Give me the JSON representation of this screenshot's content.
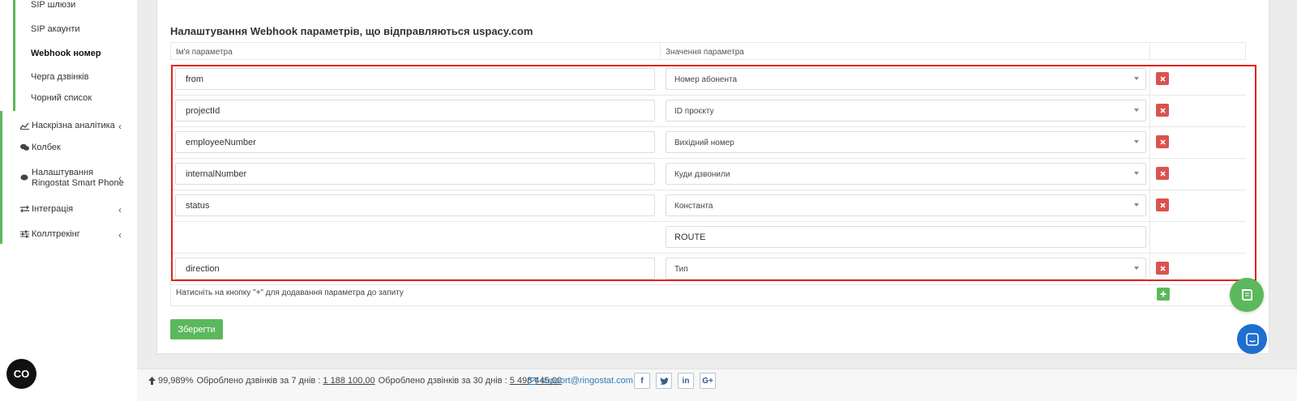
{
  "sidebar": {
    "sub_items": [
      "SIP шлюзи",
      "SIP акаунти",
      "Webhook номер",
      "Черга дзвінків",
      "Чорний список"
    ],
    "active_sub_item": "Webhook номер",
    "main_items": [
      {
        "label": "Наскрізна аналітика",
        "icon": "line-chart-icon",
        "has_chevron": true
      },
      {
        "label": "Колбек",
        "icon": "chat-bubbles-icon",
        "has_chevron": false
      },
      {
        "label_line1": "Налаштування",
        "label_line2": "Ringostat Smart Phone",
        "icon": "chat-icon",
        "has_chevron": true
      },
      {
        "label": "Інтеграція",
        "icon": "exchange-icon",
        "has_chevron": true
      },
      {
        "label": "Коллтрекінг",
        "icon": "sliders-icon",
        "has_chevron": true
      }
    ]
  },
  "panel": {
    "title": "Налаштування Webhook параметрів, що відправляються uspacy.com",
    "columns": {
      "name": "Ім'я параметра",
      "value": "Значення параметра"
    },
    "rows": [
      {
        "name": "from",
        "value": "Номер абонента",
        "type": "select"
      },
      {
        "name": "projectId",
        "value": "ID проєкту",
        "type": "select"
      },
      {
        "name": "employeeNumber",
        "value": "Вихідний номер",
        "type": "select"
      },
      {
        "name": "internalNumber",
        "value": "Куди дзвонили",
        "type": "select"
      },
      {
        "name": "status",
        "value": "Константа",
        "type": "select"
      },
      {
        "name": "",
        "value": "ROUTE",
        "type": "text"
      },
      {
        "name": "direction",
        "value": "Тип",
        "type": "select"
      }
    ],
    "hint": "Натисніть на кнопку \"+\" для додавання параметра до запиту",
    "save_label": "Зберегти"
  },
  "footer": {
    "uptime": "99,989%",
    "stat7_label": "Оброблено дзвінків за 7 днів :",
    "stat7_value": "1 188 100,00",
    "stat30_label": "Оброблено дзвінків за 30 днів :",
    "stat30_value": "5 498 445,00",
    "support_email": "support@ringostat.com",
    "socials": [
      "f",
      "t",
      "in",
      "G+"
    ]
  },
  "fabs": {
    "co_label": "CO"
  },
  "colors": {
    "accent_green": "#5cb85c",
    "danger_red": "#d9534f",
    "highlight_red": "#e0241b",
    "chat_blue": "#1f6fd1"
  }
}
